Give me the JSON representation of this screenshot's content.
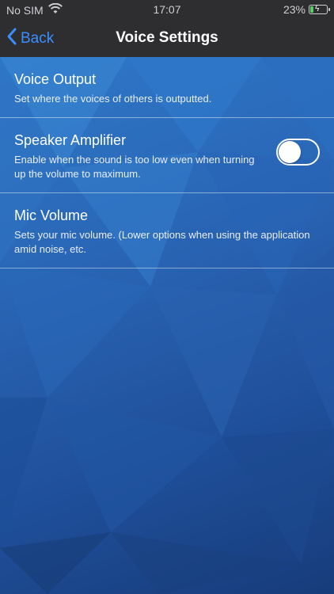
{
  "status_bar": {
    "carrier": "No SIM",
    "time": "17:07",
    "battery": "23%"
  },
  "nav": {
    "back_label": "Back",
    "title": "Voice Settings"
  },
  "settings": [
    {
      "title": "Voice Output",
      "description": "Set where the voices of others is outputted."
    },
    {
      "title": "Speaker Amplifier",
      "description": "Enable when the sound is too low even when turning up the volume to maximum.",
      "toggle_on": false
    },
    {
      "title": "Mic Volume",
      "description": "Sets your mic volume. (Lower options when using the application amid noise, etc."
    }
  ],
  "colors": {
    "accent": "#3a8fff",
    "nav_background": "#2e2e31",
    "battery_fill": "#57d163"
  }
}
